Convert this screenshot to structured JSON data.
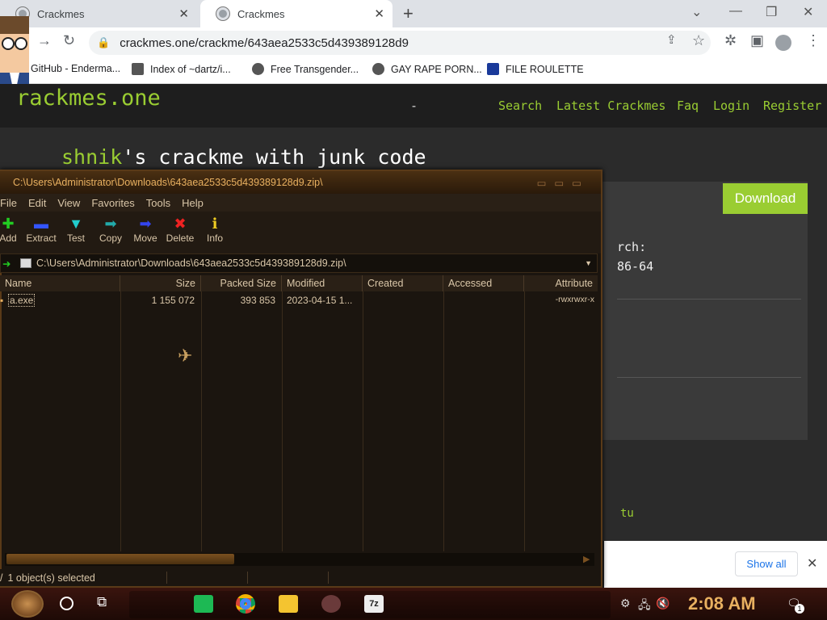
{
  "browser": {
    "tabs": [
      {
        "label": "Crackmes",
        "active": false
      },
      {
        "label": "Crackmes",
        "active": true
      }
    ],
    "url": "crackmes.one/crackme/643aea2533c5d439389128d9",
    "bookmarks": [
      {
        "label": "GitHub - Enderma...",
        "icon": "github-icon"
      },
      {
        "label": "Index of ~dartz/i...",
        "icon": "qr-icon"
      },
      {
        "label": "Free Transgender...",
        "icon": "mask-icon"
      },
      {
        "label": "GAY RAPE PORN...",
        "icon": "globe-icon"
      },
      {
        "label": "FILE ROULETTE",
        "icon": "mft-icon"
      }
    ]
  },
  "site": {
    "logo": "rackmes.one",
    "nav_sep": "-",
    "nav": [
      "Search",
      "Latest Crackmes",
      "Faq",
      "Login",
      "Register"
    ],
    "title_green": "shnik",
    "title_white": "'s crackme with junk code",
    "download_label": "Download",
    "arch_label": "rch:",
    "arch_value": "86-64",
    "user_fragment": "tu"
  },
  "downloads_bar": {
    "show_all": "Show all"
  },
  "sevenzip": {
    "title": "C:\\Users\\Administrator\\Downloads\\643aea2533c5d439389128d9.zip\\",
    "menu": [
      "File",
      "Edit",
      "View",
      "Favorites",
      "Tools",
      "Help"
    ],
    "toolbar": [
      {
        "label": "Add",
        "icon": "plus-icon",
        "color": "#22cc22"
      },
      {
        "label": "Extract",
        "icon": "minus-icon",
        "color": "#3355ff"
      },
      {
        "label": "Test",
        "icon": "check-icon",
        "color": "#22cccc"
      },
      {
        "label": "Copy",
        "icon": "arrow-right-icon",
        "color": "#22aaaa"
      },
      {
        "label": "Move",
        "icon": "arrow-right-icon",
        "color": "#3344ee"
      },
      {
        "label": "Delete",
        "icon": "x-icon",
        "color": "#ee2222"
      },
      {
        "label": "Info",
        "icon": "info-icon",
        "color": "#eecc22"
      }
    ],
    "address": "C:\\Users\\Administrator\\Downloads\\643aea2533c5d439389128d9.zip\\",
    "columns": [
      "Name",
      "Size",
      "Packed Size",
      "Modified",
      "Created",
      "Accessed",
      "Attribute"
    ],
    "rows": [
      {
        "name": "a.exe",
        "size": "1 155 072",
        "packed": "393 853",
        "modified": "2023-04-15 1...",
        "created": "",
        "accessed": "",
        "attr": "-rwxrwxr-x"
      }
    ],
    "status": "1 object(s) selected"
  },
  "taskbar": {
    "clock": "2:08 AM",
    "notification_count": "1"
  }
}
